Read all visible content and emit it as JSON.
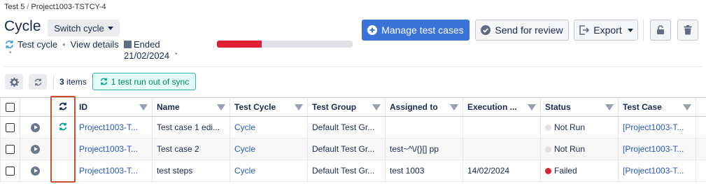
{
  "breadcrumb": {
    "project": "Test 5",
    "cycle": "Project1003-TSTCY-4"
  },
  "title": "Cycle",
  "switch_cycle_label": "Switch cycle",
  "meta": {
    "test_cycle": "Test cycle",
    "view_details": "View details",
    "ended_label": "Ended",
    "ended_date": "21/02/2024"
  },
  "progress": {
    "failed_fraction": 0.33,
    "fill_color": "#de2034"
  },
  "buttons": {
    "manage": "Manage test cases",
    "review": "Send for review",
    "export": "Export"
  },
  "toolbar": {
    "items_count": "3",
    "items_label": "items",
    "sync_badge": "1 test run out of sync"
  },
  "table": {
    "headers": {
      "id": "ID",
      "name": "Name",
      "test_cycle": "Test Cycle",
      "test_group": "Test Group",
      "assigned_to": "Assigned to",
      "execution": "Execution ...",
      "status": "Status",
      "test_case": "Test Case"
    },
    "rows": [
      {
        "id": "Project1003-T...",
        "name": "Test case 1 edi...",
        "test_cycle": "Cycle",
        "test_group": "Default Test Gr...",
        "assigned_to": "",
        "execution": "",
        "status": "Not Run",
        "status_color": "#dfe1e6",
        "test_case": "[Project1003-T...",
        "out_of_sync": true
      },
      {
        "id": "Project1003-T...",
        "name": "Test case 2",
        "test_cycle": "Cycle",
        "test_group": "Default Test Gr...",
        "assigned_to": "test~^\\/{}[] pp",
        "execution": "",
        "status": "Not Run",
        "status_color": "#dfe1e6",
        "test_case": "[Project1003-T...",
        "out_of_sync": false
      },
      {
        "id": "Project1003-T...",
        "name": "test steps",
        "test_cycle": "Cycle",
        "test_group": "Default Test Gr...",
        "assigned_to": "test 1003",
        "execution": "14/02/2024",
        "status": "Failed",
        "status_color": "#de2034",
        "test_case": "[Project1003-T...",
        "out_of_sync": false
      }
    ]
  },
  "colors": {
    "primary": "#3b73d9",
    "sync": "#36b3a8",
    "link": "#2a5ab8",
    "highlight": "#c9502d"
  }
}
